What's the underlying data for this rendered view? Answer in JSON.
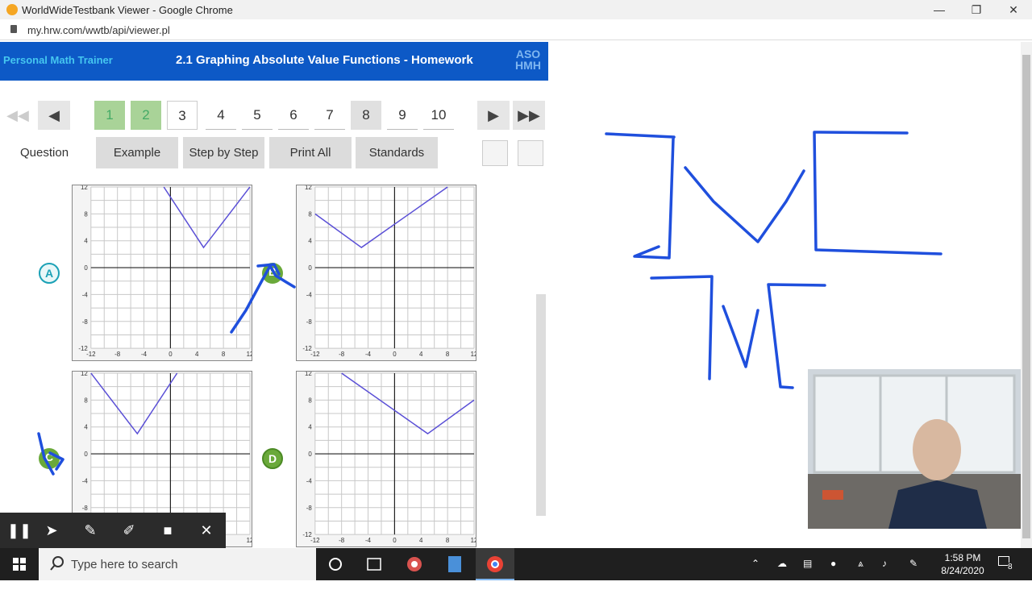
{
  "window": {
    "title": "WorldWideTestbank Viewer - Google Chrome",
    "url": "my.hrw.com/wwtb/api/viewer.pl"
  },
  "header": {
    "product": "Personal Math Trainer",
    "lesson_title": "2.1 Graphing Absolute Value Functions - Homework",
    "logo_line1": "ASO",
    "logo_line2": "HMH"
  },
  "questions": [
    "1",
    "2",
    "3",
    "4",
    "5",
    "6",
    "7",
    "8",
    "9",
    "10"
  ],
  "tabs": {
    "question": "Question",
    "example": "Example",
    "step_by_step": "Step by Step",
    "print_all": "Print All",
    "standards": "Standards"
  },
  "choices": {
    "a": "A",
    "b": "B",
    "c": "C",
    "d": "D"
  },
  "graph_axis": {
    "x_ticks": [
      "-12",
      "-8",
      "-4",
      "0",
      "4",
      "8",
      "12"
    ],
    "y_ticks": [
      "12",
      "8",
      "4",
      "0",
      "-4",
      "-8",
      "-12"
    ]
  },
  "chart_data": [
    {
      "type": "line",
      "name": "A",
      "x": [
        -1,
        5,
        12
      ],
      "y": [
        12,
        3,
        12
      ],
      "xlim": [
        -12,
        12
      ],
      "ylim": [
        -12,
        12
      ]
    },
    {
      "type": "line",
      "name": "B",
      "x": [
        -12,
        -5,
        8
      ],
      "y": [
        8,
        3,
        12
      ],
      "xlim": [
        -12,
        12
      ],
      "ylim": [
        -12,
        12
      ]
    },
    {
      "type": "line",
      "name": "C",
      "x": [
        -12,
        -5,
        1
      ],
      "y": [
        12,
        3,
        12
      ],
      "xlim": [
        -12,
        12
      ],
      "ylim": [
        -12,
        12
      ]
    },
    {
      "type": "line",
      "name": "D",
      "x": [
        -8,
        5,
        12
      ],
      "y": [
        12,
        3,
        8
      ],
      "xlim": [
        -12,
        12
      ],
      "ylim": [
        -12,
        12
      ]
    }
  ],
  "taskbar": {
    "search_placeholder": "Type here to search",
    "time": "1:58 PM",
    "date": "8/24/2020",
    "notification_count": "8"
  }
}
